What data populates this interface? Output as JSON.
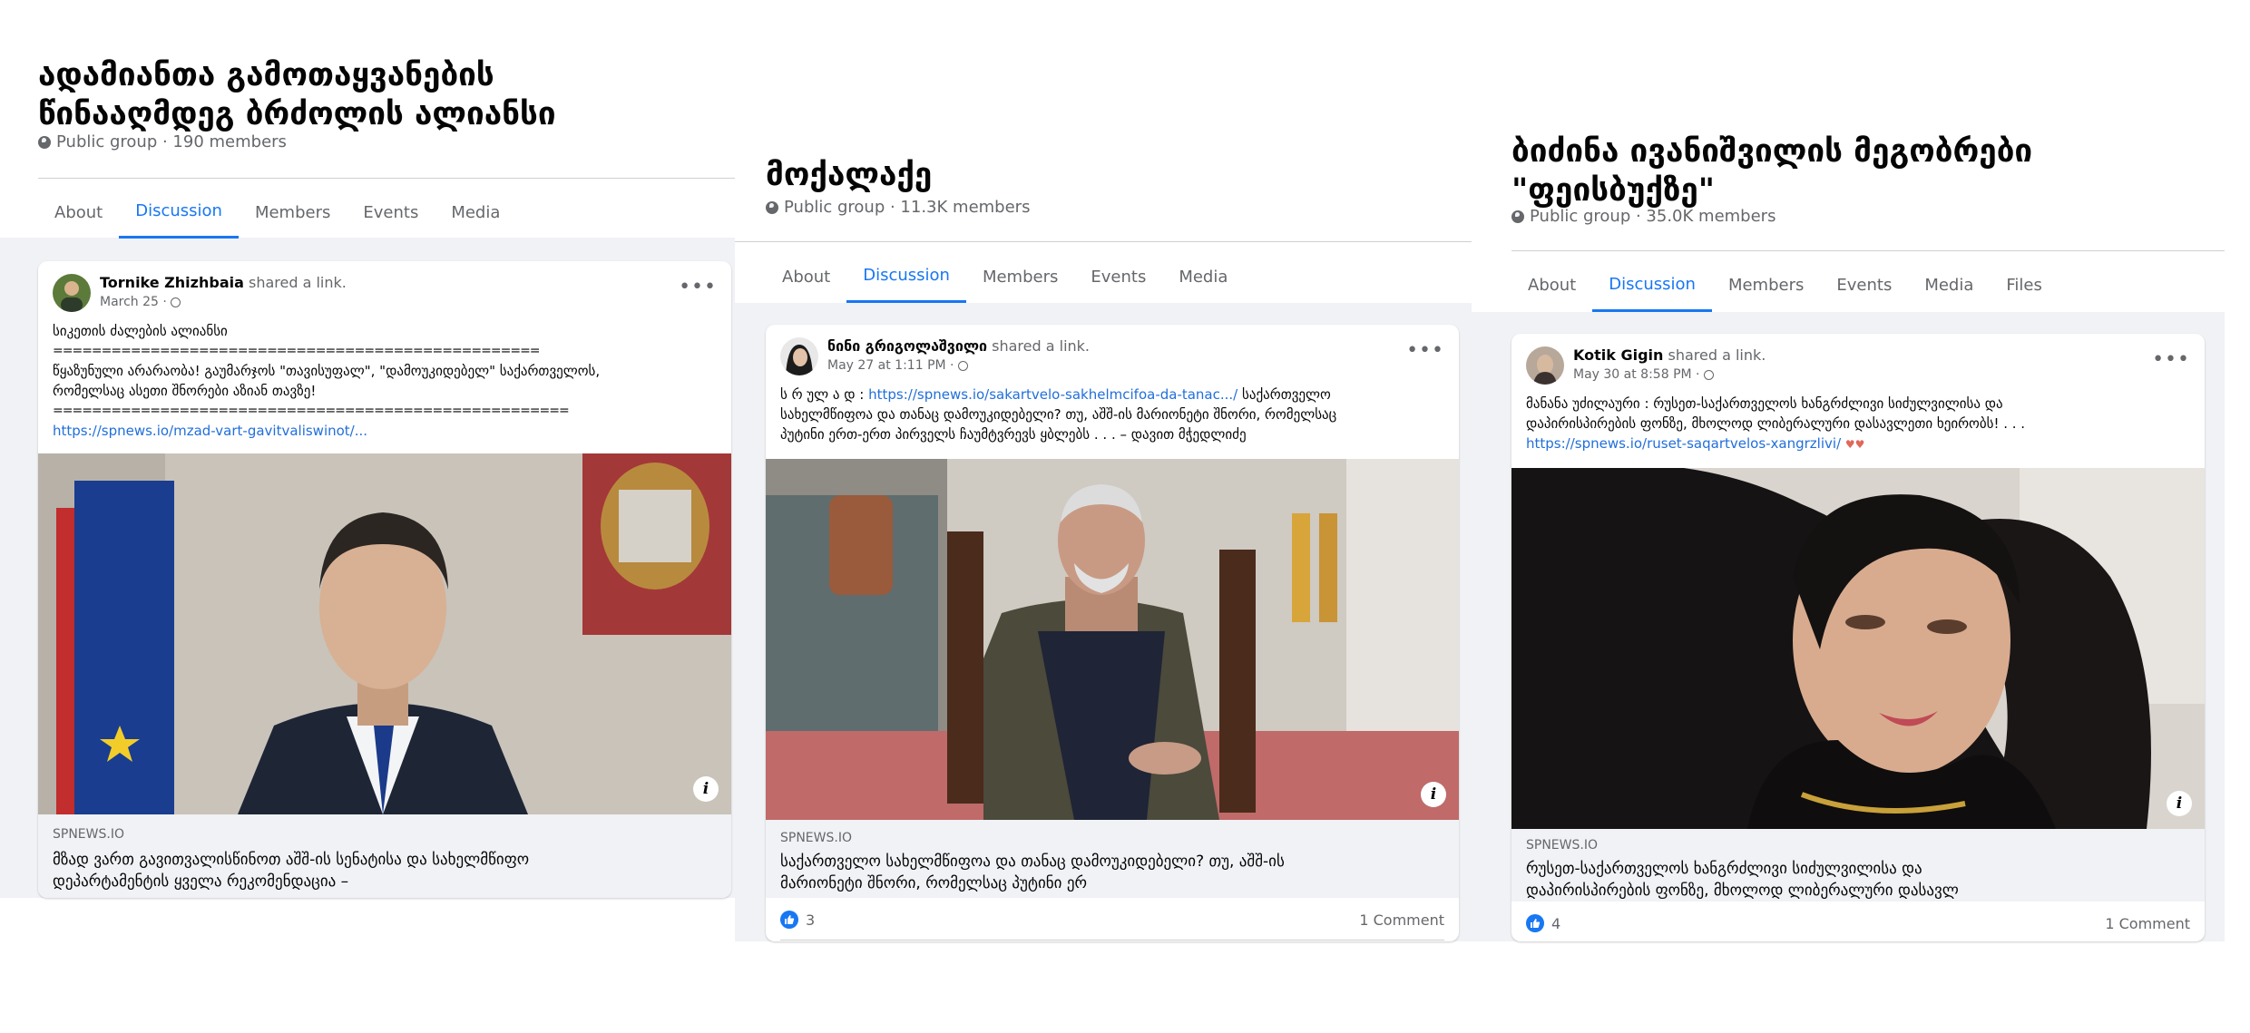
{
  "panels": [
    {
      "group_title_line1": "ადამიანთა გამოთაყვანების",
      "group_title_line2": "წინააღმდეგ ბრძოლის ალიანსი",
      "group_meta": "Public group · 190 members",
      "tabs": [
        {
          "label": "About",
          "active": false
        },
        {
          "label": "Discussion",
          "active": true
        },
        {
          "label": "Members",
          "active": false
        },
        {
          "label": "Events",
          "active": false
        },
        {
          "label": "Media",
          "active": false
        }
      ],
      "post": {
        "author": "Tornike Zhizhbaia",
        "action": " shared a link.",
        "date": "March 25 ·",
        "text_lines": [
          "სიკეთის ძალების ალიანსი",
          "==================================================",
          "წყაზუნული არარაობა! გაუმარჯოს \"თავისუფალ\", \"დამოუკიდებელ\" საქართველოს,",
          "რომელსაც ასეთი შნორები აზიან თავზე!",
          "====================================================="
        ],
        "link_text": "https://spnews.io/mzad-vart-gavitvaliswinot/...",
        "link_domain": "SPNEWS.IO",
        "link_title_line1": "მზად ვართ გავითვალისწინოთ აშშ-ის სენატისა და სახელმწიფო",
        "link_title_line2": "დეპარტამენტის ყველა რეკომენდაცია –"
      }
    },
    {
      "group_title_line1": "მოქალაქე",
      "group_meta": "Public group · 11.3K members",
      "tabs": [
        {
          "label": "About",
          "active": false
        },
        {
          "label": "Discussion",
          "active": true
        },
        {
          "label": "Members",
          "active": false
        },
        {
          "label": "Events",
          "active": false
        },
        {
          "label": "Media",
          "active": false
        }
      ],
      "post": {
        "author": "ნინი გრიგოლაშვილი",
        "action": " shared a link.",
        "date": "May 27 at 1:11 PM ·",
        "text_prefix": "ს რ ულ ა დ : ",
        "link_text": "https://spnews.io/sakartvelo-sakhelmcifoa-da-tanac.../",
        "text_suffix": " საქართველო",
        "text_lines": [
          "სახელმწიფოა და თანაც დამოუკიდებელი? თუ, აშშ-ის მარიონეტი შნორი, რომელსაც",
          "პუტინი ერთ-ერთ პირველს ჩაუმტვრევს ყბლებს . . . – დავით მჭედლიძე"
        ],
        "link_domain": "SPNEWS.IO",
        "link_title_line1": "საქართველო სახელმწიფოა და თანაც დამოუკიდებელი? თუ, აშშ-ის",
        "link_title_line2": "მარიონეტი შნორი, რომელსაც პუტინი ერ",
        "likes": "3",
        "comments": "1 Comment"
      }
    },
    {
      "group_title_line1": "ბიძინა ივანიშვილის მეგობრები",
      "group_title_line2": "\"ფეისბუქზე\"",
      "group_meta": "Public group · 35.0K members",
      "tabs": [
        {
          "label": "About",
          "active": false
        },
        {
          "label": "Discussion",
          "active": true
        },
        {
          "label": "Members",
          "active": false
        },
        {
          "label": "Events",
          "active": false
        },
        {
          "label": "Media",
          "active": false
        },
        {
          "label": "Files",
          "active": false
        }
      ],
      "post": {
        "author": "Kotik Gigin",
        "action": " shared a link.",
        "date": "May 30 at 8:58 PM ·",
        "text_lines": [
          "მანანა უძილაური : რუსეთ-საქართველოს ხანგრძლივი სიძულვილისა და",
          "დაპირისპირების ფონზე, მხოლოდ ლიბერალური დასავლეთი ხეირობს! . . ."
        ],
        "link_text": "https://spnews.io/ruset-saqartvelos-xangrzlivi/",
        "link_domain": "SPNEWS.IO",
        "link_title_line1": "რუსეთ-საქართველოს ხანგრძლივი სიძულვილისა და",
        "link_title_line2": "დაპირისპირების ფონზე, მხოლოდ ლიბერალური დასავლ",
        "likes": "4",
        "comments": "1 Comment"
      }
    }
  ],
  "colors": {
    "accent": "#1877f2",
    "link": "#216fdb",
    "background": "#f0f2f5",
    "secondary_text": "#65676b"
  },
  "icons": [
    "globe-icon",
    "more-options-icon",
    "info-icon",
    "like-icon"
  ]
}
